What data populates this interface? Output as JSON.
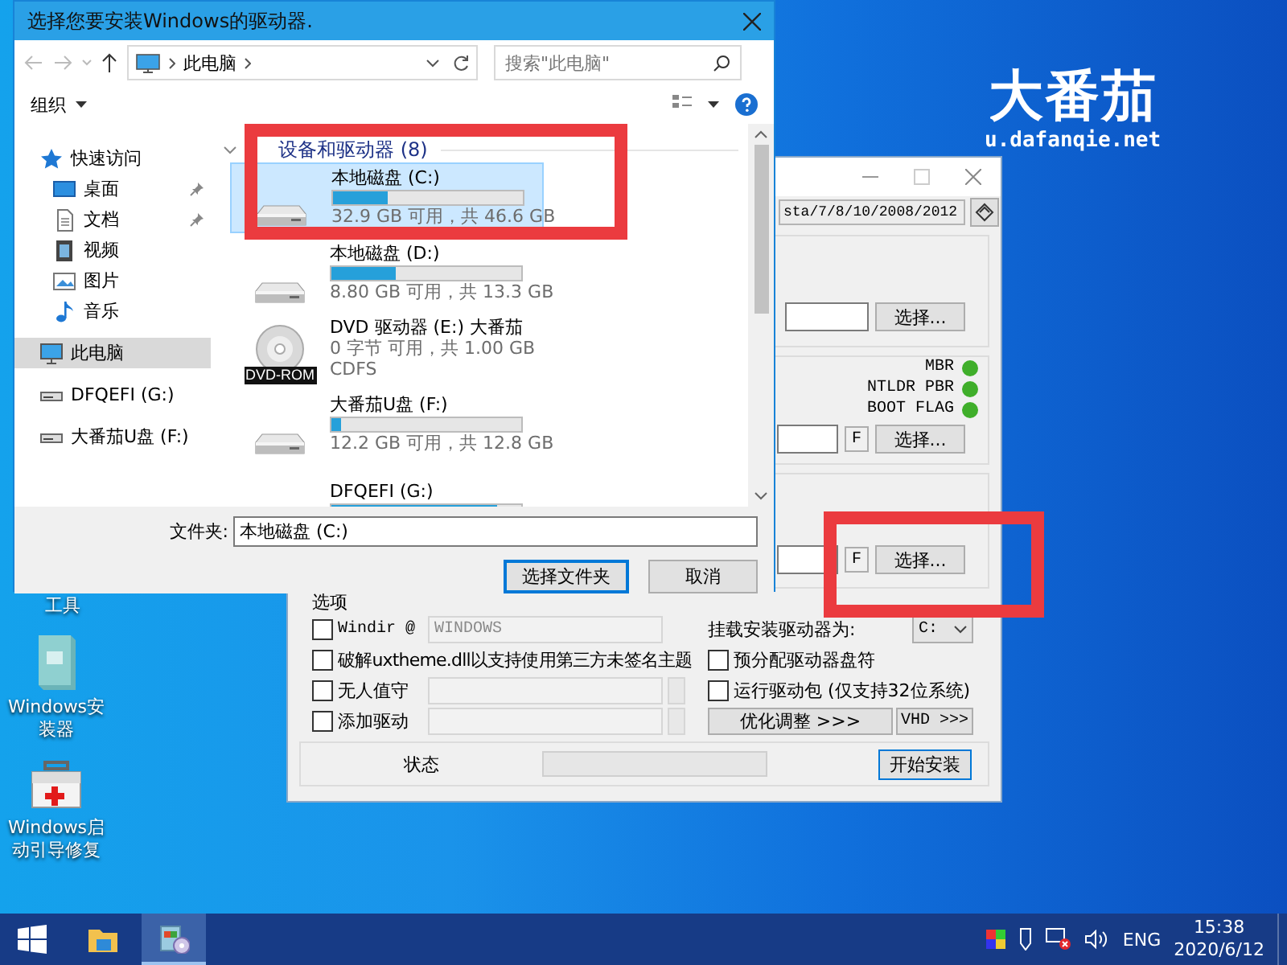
{
  "desktop": {
    "logo": {
      "title": "大番茄",
      "url": "u.dafanqie.net"
    },
    "icons": [
      {
        "label": "工具",
        "kind": "covered"
      },
      {
        "label": "Windows安装器",
        "kind": "installer"
      },
      {
        "label": "Windows启动引导修复",
        "kind": "toolbox"
      }
    ]
  },
  "installer": {
    "version_text": "sta/7/8/10/2008/2012",
    "source_row": {
      "button": "选择..."
    },
    "boot_row": {
      "indicators": [
        {
          "label": "MBR",
          "color": "#3fae2a"
        },
        {
          "label": "NTLDR PBR",
          "color": "#3fae2a"
        },
        {
          "label": "BOOT FLAG",
          "color": "#3fae2a"
        }
      ],
      "format_button": "F",
      "button": "选择..."
    },
    "target_row": {
      "format_button": "F",
      "button": "选择..."
    },
    "options": {
      "title": "选项",
      "left": [
        {
          "kind": "field",
          "label": "Windir @",
          "checked": false,
          "value": "WINDOWS"
        },
        {
          "kind": "plain",
          "label": "破解uxtheme.dll以支持使用第三方未签名主题",
          "checked": false
        },
        {
          "kind": "browse",
          "label": "无人值守",
          "checked": false
        },
        {
          "kind": "browse",
          "label": "添加驱动",
          "checked": false
        }
      ],
      "mount": {
        "label": "挂载安装驱动器为:",
        "value": "C:"
      },
      "right": [
        {
          "label": "预分配驱动器盘符",
          "checked": false
        },
        {
          "label": "运行驱动包 (仅支持32位系统)",
          "checked": false
        }
      ],
      "buttons": [
        "优化调整 >>>",
        "VHD >>>"
      ]
    },
    "status": {
      "label": "状态",
      "level": 0,
      "button": "开始安装"
    }
  },
  "explorer": {
    "title": "选择您要安装Windows的驱动器.",
    "path": "此电脑",
    "search_placeholder": "搜索\"此电脑\"",
    "organize": "组织",
    "nav": [
      {
        "label": "快速访问",
        "kind": "quick",
        "selected": false,
        "children": [
          {
            "label": "桌面",
            "kind": "desktop",
            "pinned": true,
            "selected": false
          },
          {
            "label": "文档",
            "kind": "documents",
            "pinned": true,
            "selected": false
          },
          {
            "label": "视频",
            "kind": "videos",
            "pinned": false,
            "selected": false
          },
          {
            "label": "图片",
            "kind": "pictures",
            "pinned": false,
            "selected": false
          },
          {
            "label": "音乐",
            "kind": "music",
            "pinned": false,
            "selected": false
          }
        ]
      },
      {
        "label": "此电脑",
        "kind": "pc",
        "selected": true
      },
      {
        "label": "DFQEFI (G:)",
        "kind": "drive",
        "selected": false
      },
      {
        "label": "大番茄U盘 (F:)",
        "kind": "drive",
        "selected": false
      }
    ],
    "group": "设备和驱动器 (8)",
    "drives": [
      {
        "kind": "disk",
        "name": "本地磁盘 (C:)",
        "level": 0.29,
        "detail": "32.9 GB 可用，共 46.6 GB",
        "selected": true
      },
      {
        "kind": "disk",
        "name": "本地磁盘 (D:)",
        "level": 0.34,
        "detail": "8.80 GB 可用，共 13.3 GB",
        "selected": false
      },
      {
        "kind": "dvd",
        "name": "DVD 驱动器 (E:) 大番茄",
        "detail": "0 字节 可用，共 1.00 GB",
        "filesystem": "CDFS",
        "badge": "DVD-ROM",
        "selected": false
      },
      {
        "kind": "disk",
        "name": "大番茄U盘 (F:)",
        "level": 0.05,
        "detail": "12.2 GB 可用，共 12.8 GB",
        "selected": false
      },
      {
        "kind": "disk",
        "name": "DFQEFI (G:)",
        "level": 0.87,
        "selected": false
      }
    ],
    "folder_label": "文件夹:",
    "folder_value": "本地磁盘 (C:)",
    "buttons": [
      {
        "label": "选择文件夹",
        "default": true
      },
      {
        "label": "取消",
        "default": false
      }
    ]
  },
  "taskbar": {
    "apps": [
      {
        "kind": "explorer",
        "selected": false
      },
      {
        "kind": "installer",
        "selected": true
      }
    ],
    "tray": {
      "language": "ENG",
      "time": "15:38",
      "date": "2020/6/12"
    }
  }
}
